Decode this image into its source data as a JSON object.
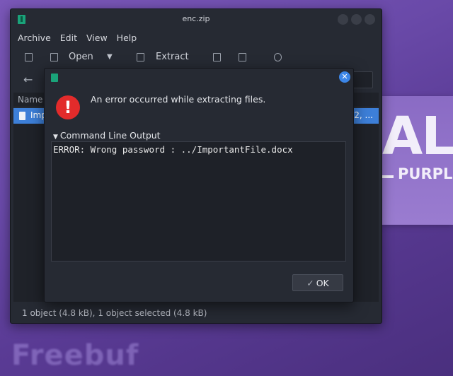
{
  "background": {
    "big_text": "ALI",
    "small_text": "PURPLE",
    "watermark": "Freebuf"
  },
  "main_window": {
    "title": "enc.zip",
    "menu": [
      "Archive",
      "Edit",
      "View",
      "Help"
    ],
    "toolbar": {
      "open_label": "Open",
      "extract_label": "Extract"
    },
    "file_list": {
      "header_name": "Name",
      "rows": [
        {
          "name": "Imp",
          "date": "2, ..."
        }
      ]
    },
    "status_text": "1 object (4.8 kB), 1 object selected (4.8 kB)"
  },
  "dialog": {
    "message": "An error occurred while extracting files.",
    "expander_label": "Command Line Output",
    "output": "ERROR: Wrong password : ../ImportantFile.docx",
    "ok_label": "OK"
  },
  "colors": {
    "accent": "#3d7fd8",
    "error": "#e22b2b",
    "window_bg": "#262a33"
  }
}
